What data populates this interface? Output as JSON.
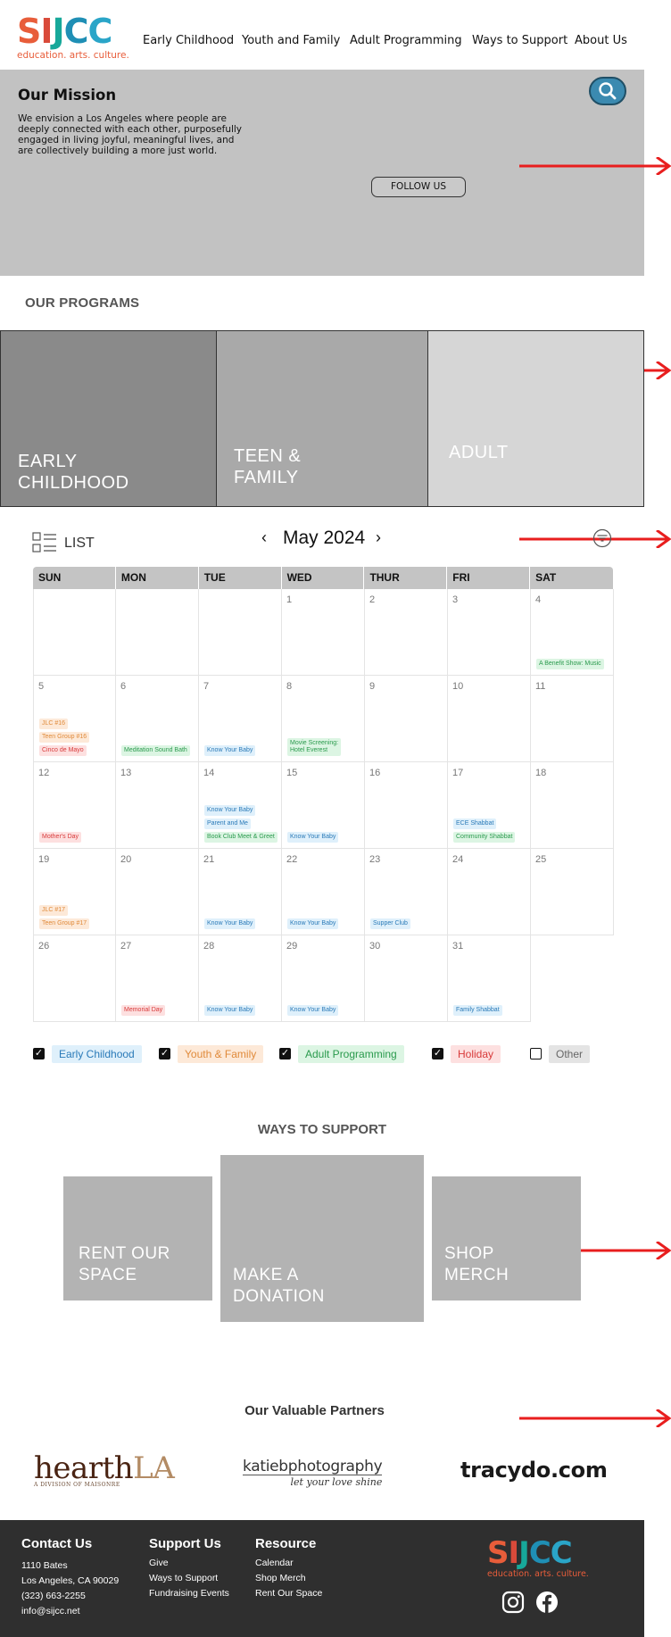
{
  "header": {
    "logo": {
      "letters": [
        "S",
        "I",
        "J",
        "C",
        "C"
      ],
      "tagline": "education. arts. culture."
    },
    "nav": [
      "Early Childhood",
      "Youth and Family",
      "Adult Programming",
      "Ways to Support",
      "About Us"
    ]
  },
  "mission": {
    "title": "Our Mission",
    "text": "We envision a Los Angeles where people are deeply connected with each other, purposefully engaged in living joyful, meaningful lives, and are collectively building a more just world.",
    "follow_label": "FOLLOW US"
  },
  "programs": {
    "title": "OUR PROGRAMS",
    "items": [
      "EARLY CHILDHOOD",
      "TEEN & FAMILY",
      "ADULT"
    ]
  },
  "calendar": {
    "view_label": "LIST",
    "month": "May 2024",
    "prev": "‹",
    "next": "›",
    "days": [
      "SUN",
      "MON",
      "TUE",
      "WED",
      "THUR",
      "FRI",
      "SAT"
    ],
    "weeks": [
      [
        {
          "num": "",
          "events": []
        },
        {
          "num": "",
          "events": []
        },
        {
          "num": "",
          "events": []
        },
        {
          "num": "1",
          "events": []
        },
        {
          "num": "2",
          "events": []
        },
        {
          "num": "3",
          "events": []
        },
        {
          "num": "4",
          "events": [
            {
              "label": "A Benefit Show: Music",
              "cat": "green"
            }
          ]
        }
      ],
      [
        {
          "num": "5",
          "events": [
            {
              "label": "JLC #16",
              "cat": "orange"
            },
            {
              "label": "Teen Group #16",
              "cat": "orange"
            },
            {
              "label": "Cinco de Mayo",
              "cat": "red"
            }
          ]
        },
        {
          "num": "6",
          "events": [
            {
              "label": "Meditation Sound Bath",
              "cat": "green"
            }
          ]
        },
        {
          "num": "7",
          "events": [
            {
              "label": "Know Your Baby",
              "cat": "blue"
            }
          ]
        },
        {
          "num": "8",
          "events": [
            {
              "label": "Movie Screening:\nHotel Everest",
              "cat": "green"
            }
          ]
        },
        {
          "num": "9",
          "events": []
        },
        {
          "num": "10",
          "events": []
        },
        {
          "num": "11",
          "events": []
        }
      ],
      [
        {
          "num": "12",
          "events": [
            {
              "label": "Mother's Day",
              "cat": "red"
            }
          ]
        },
        {
          "num": "13",
          "events": []
        },
        {
          "num": "14",
          "events": [
            {
              "label": "Know Your Baby",
              "cat": "blue"
            },
            {
              "label": "Parent and Me",
              "cat": "blue"
            },
            {
              "label": "Book Club Meet & Greet",
              "cat": "green"
            }
          ]
        },
        {
          "num": "15",
          "events": [
            {
              "label": "Know Your Baby",
              "cat": "blue"
            }
          ]
        },
        {
          "num": "16",
          "events": []
        },
        {
          "num": "17",
          "events": [
            {
              "label": "ECE Shabbat",
              "cat": "blue"
            },
            {
              "label": "Community Shabbat",
              "cat": "green"
            }
          ]
        },
        {
          "num": "18",
          "events": []
        }
      ],
      [
        {
          "num": "19",
          "events": [
            {
              "label": "JLC #17",
              "cat": "orange"
            },
            {
              "label": "Teen Group #17",
              "cat": "orange"
            }
          ]
        },
        {
          "num": "20",
          "events": []
        },
        {
          "num": "21",
          "events": [
            {
              "label": "Know Your Baby",
              "cat": "blue"
            }
          ]
        },
        {
          "num": "22",
          "events": [
            {
              "label": "Know Your Baby",
              "cat": "blue"
            }
          ]
        },
        {
          "num": "23",
          "events": [
            {
              "label": "Supper Club",
              "cat": "blue"
            }
          ]
        },
        {
          "num": "24",
          "events": []
        },
        {
          "num": "25",
          "events": []
        }
      ],
      [
        {
          "num": "26",
          "events": []
        },
        {
          "num": "27",
          "events": [
            {
              "label": "Memorial Day",
              "cat": "red"
            }
          ]
        },
        {
          "num": "28",
          "events": [
            {
              "label": "Know Your Baby",
              "cat": "blue"
            }
          ]
        },
        {
          "num": "29",
          "events": [
            {
              "label": "Know Your Baby",
              "cat": "blue"
            }
          ]
        },
        {
          "num": "30",
          "events": []
        },
        {
          "num": "31",
          "events": [
            {
              "label": "Family Shabbat",
              "cat": "blue"
            }
          ]
        }
      ]
    ],
    "legend": [
      {
        "label": "Early Childhood",
        "checked": true,
        "cat": "blue"
      },
      {
        "label": "Youth & Family",
        "checked": true,
        "cat": "orange"
      },
      {
        "label": "Adult Programming",
        "checked": true,
        "cat": "green"
      },
      {
        "label": "Holiday",
        "checked": true,
        "cat": "red"
      },
      {
        "label": "Other",
        "checked": false,
        "cat": "gray"
      }
    ]
  },
  "support": {
    "title": "WAYS TO SUPPORT",
    "items": [
      "RENT OUR SPACE",
      "MAKE A DONATION",
      "SHOP MERCH"
    ]
  },
  "partners": {
    "title": "Our Valuable Partners",
    "logos": [
      {
        "name": "hearthLA",
        "main_dark": "hearth",
        "main_light": "LA",
        "sub": "A DIVISION OF MAISONRE"
      },
      {
        "name": "katiebphotography",
        "main": "katiebphotography",
        "sub": "let your love shine"
      },
      {
        "name": "tracydo.com",
        "main": "tracydo.com"
      }
    ]
  },
  "footer": {
    "contact": {
      "title": "Contact Us",
      "lines": [
        "1110 Bates",
        "Los Angeles, CA 90029",
        "(323) 663-2255",
        "info@sijcc.net"
      ]
    },
    "support": {
      "title": "Support Us",
      "lines": [
        "Give",
        "Ways to Support",
        "Fundraising Events"
      ]
    },
    "resource": {
      "title": "Resource",
      "lines": [
        "Calendar",
        "Shop Merch",
        "Rent Our Space"
      ]
    },
    "logo": {
      "letters": [
        "S",
        "I",
        "J",
        "C",
        "C"
      ],
      "tagline": "education. arts. culture."
    }
  },
  "colors": {
    "logo_s": "#e85d3a",
    "logo_i": "#d94a3a",
    "logo_j": "#17a89a",
    "logo_c1": "#1f8fb5",
    "logo_c2": "#2aa5c8",
    "arrow": "#e81e1e"
  },
  "icons": [
    "search-icon",
    "list-view-icon",
    "filter-icon",
    "instagram-icon",
    "facebook-icon",
    "red-arrow-icon"
  ]
}
